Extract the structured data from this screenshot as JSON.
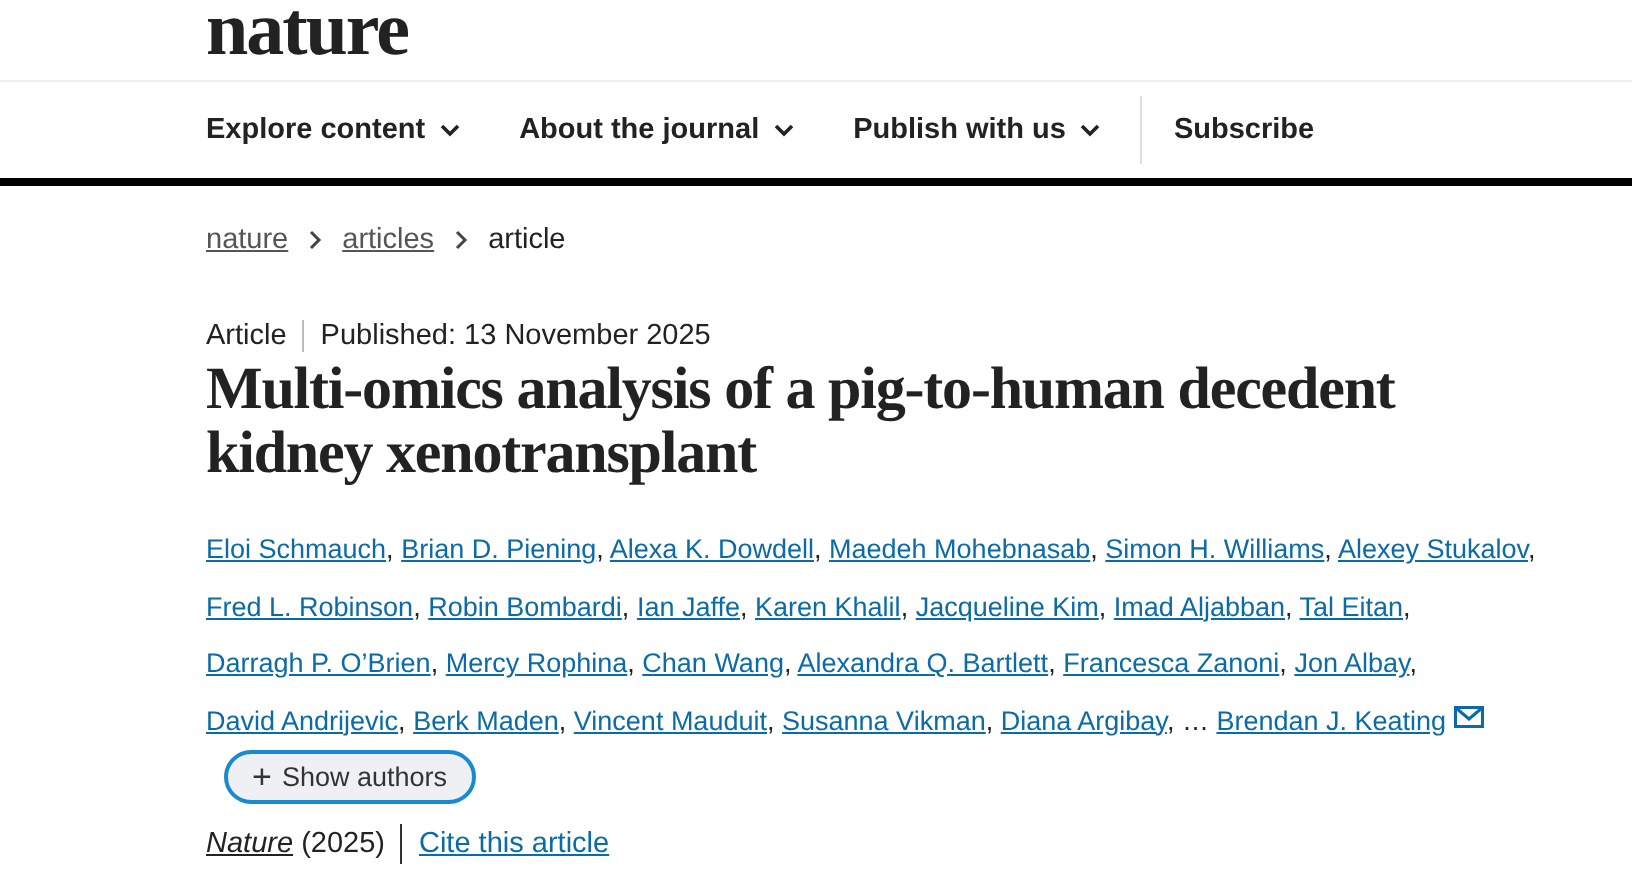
{
  "logo": "nature",
  "nav": [
    {
      "label": "Explore content",
      "dropdown": true
    },
    {
      "label": "About the journal",
      "dropdown": true
    },
    {
      "label": "Publish with us",
      "dropdown": true
    },
    {
      "label": "Subscribe",
      "dropdown": false
    }
  ],
  "breadcrumbs": [
    {
      "label": "nature",
      "link": true
    },
    {
      "label": "articles",
      "link": true
    },
    {
      "label": "article",
      "link": false
    }
  ],
  "article": {
    "type": "Article",
    "published": "Published: 13 November 2025",
    "title": "Multi-omics analysis of a pig-to-human decedent kidney xenotransplant"
  },
  "authors": {
    "separator": ",",
    "items": [
      {
        "kind": "author",
        "name": "Eloi Schmauch"
      },
      {
        "kind": "author",
        "name": "Brian D. Piening"
      },
      {
        "kind": "author",
        "name": "Alexa K. Dowdell"
      },
      {
        "kind": "author",
        "name": "Maedeh Mohebnasab"
      },
      {
        "kind": "author",
        "name": "Simon H. Williams"
      },
      {
        "kind": "author",
        "name": "Alexey Stukalov"
      },
      {
        "kind": "author",
        "name": "Fred L. Robinson"
      },
      {
        "kind": "author",
        "name": "Robin Bombardi"
      },
      {
        "kind": "author",
        "name": "Ian Jaffe"
      },
      {
        "kind": "author",
        "name": "Karen Khalil"
      },
      {
        "kind": "author",
        "name": "Jacqueline Kim"
      },
      {
        "kind": "author",
        "name": "Imad Aljabban"
      },
      {
        "kind": "author",
        "name": "Tal Eitan"
      },
      {
        "kind": "author",
        "name": "Darragh P. O’Brien"
      },
      {
        "kind": "author",
        "name": "Mercy Rophina"
      },
      {
        "kind": "author",
        "name": "Chan Wang"
      },
      {
        "kind": "author",
        "name": "Alexandra Q. Bartlett"
      },
      {
        "kind": "author",
        "name": "Francesca Zanoni"
      },
      {
        "kind": "author",
        "name": "Jon Albay"
      },
      {
        "kind": "author",
        "name": "David Andrijevic"
      },
      {
        "kind": "author",
        "name": "Berk Maden"
      },
      {
        "kind": "author",
        "name": "Vincent Mauduit"
      },
      {
        "kind": "author",
        "name": "Susanna Vikman"
      },
      {
        "kind": "author",
        "name": "Diana Argibay"
      },
      {
        "kind": "ellipsis",
        "name": "…"
      },
      {
        "kind": "author",
        "name": "Brendan J. Keating",
        "corresponding": true
      }
    ]
  },
  "show_authors": {
    "icon": "+",
    "label": "Show authors"
  },
  "citation": {
    "journal": "Nature",
    "year": "(2025)",
    "cite": "Cite this article"
  }
}
